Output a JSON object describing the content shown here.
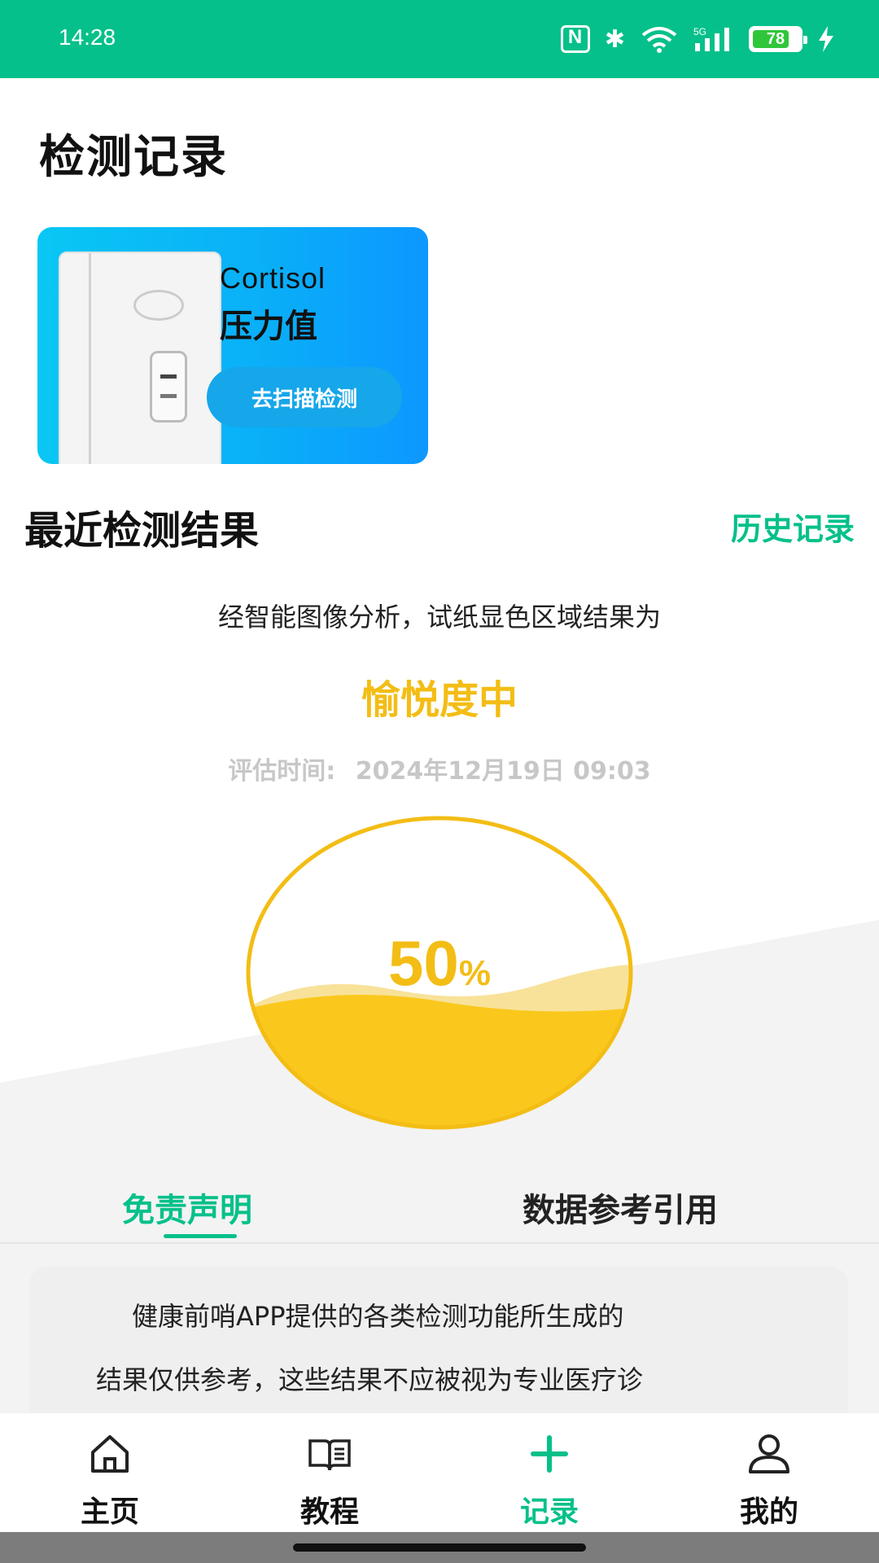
{
  "status_bar": {
    "time": "14:28",
    "battery": "78",
    "network": "5G"
  },
  "header": {
    "title": "检测记录"
  },
  "scan_card": {
    "title_en": "Cortisol",
    "title_cn": "压力值",
    "button": "去扫描检测"
  },
  "recent": {
    "title": "最近检测结果",
    "history_link": "历史记录",
    "analysis_text": "经智能图像分析，试纸显色区域结果为",
    "result": "愉悦度中",
    "eval_label": "评估时间:",
    "eval_time": "2024年12月19日  09:03"
  },
  "gauge": {
    "value": "50",
    "unit": "%",
    "fill_level": 0.5,
    "color": "#f3bd15"
  },
  "tabs": {
    "disclaimer": "免责声明",
    "reference": "数据参考引用",
    "active": "disclaimer"
  },
  "disclaimer": {
    "line1": "健康前哨APP提供的各类检测功能所生成的",
    "line2": "结果仅供参考，这些结果不应被视为专业医疗诊"
  },
  "nav": {
    "home": "主页",
    "tutorial": "教程",
    "records": "记录",
    "mine": "我的",
    "active": "records"
  },
  "colors": {
    "accent": "#05c08a",
    "gauge": "#f3bd15",
    "card": "#0aaef8"
  },
  "icons": [
    "nfc-icon",
    "bluetooth-icon",
    "wifi-icon",
    "signal-icon",
    "battery-icon",
    "charging-icon",
    "home-icon",
    "book-icon",
    "plus-icon",
    "user-icon"
  ]
}
